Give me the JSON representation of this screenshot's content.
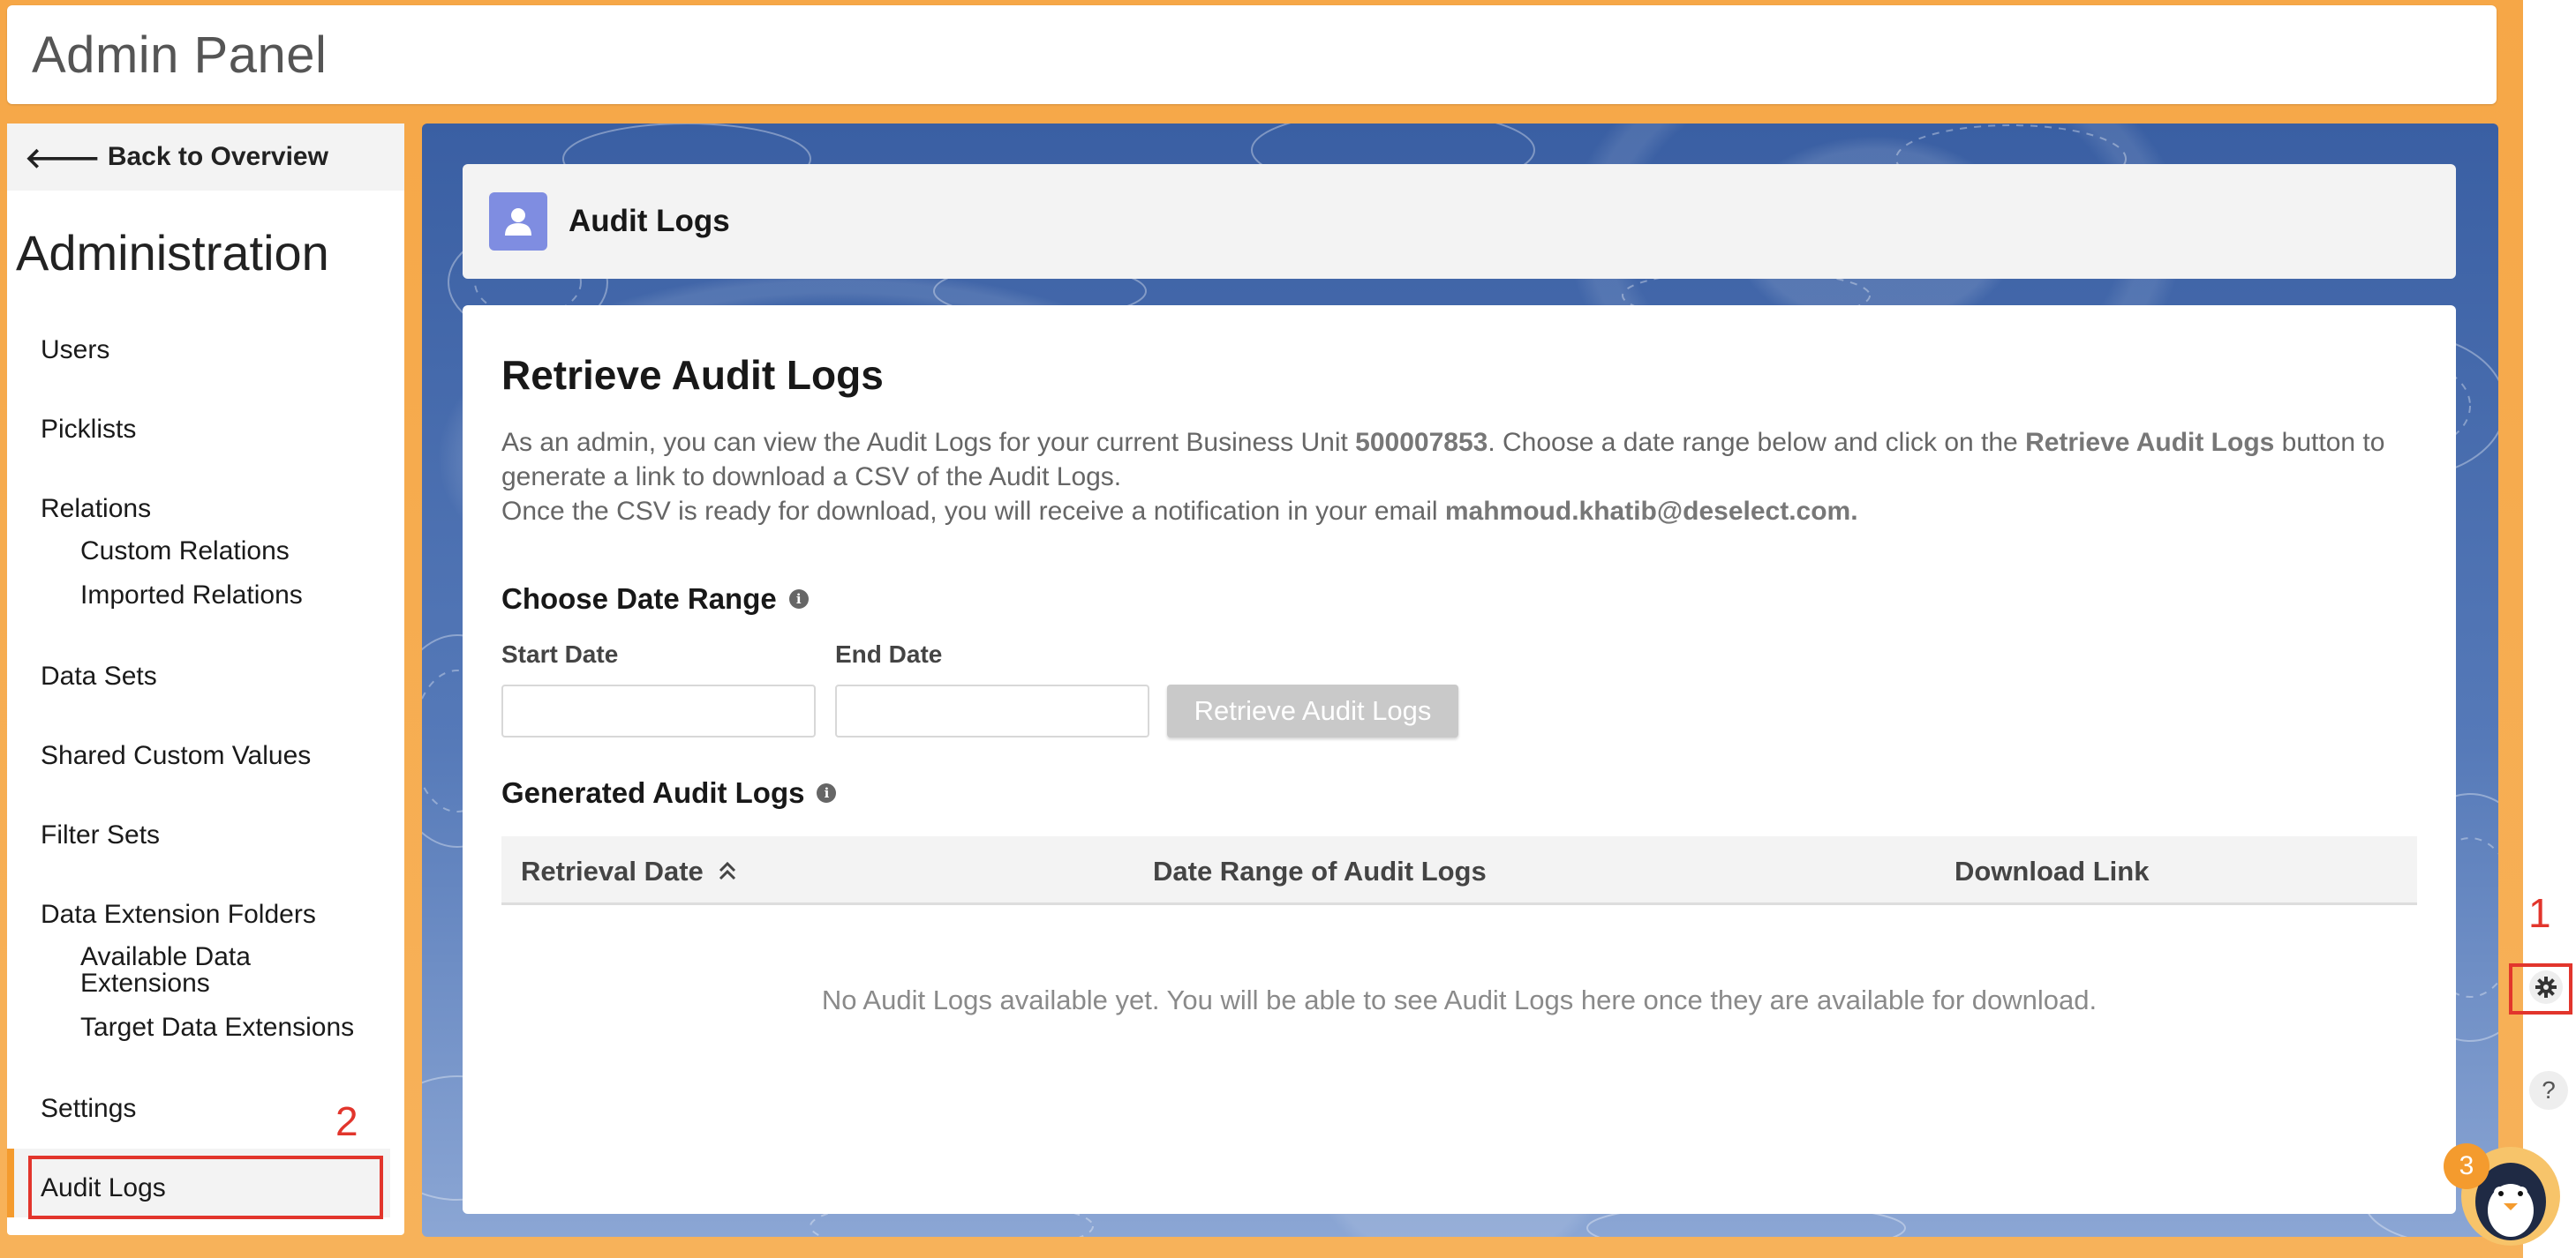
{
  "app": {
    "title": "Admin Panel"
  },
  "sidebar": {
    "back_label": "Back to Overview",
    "heading": "Administration",
    "items": [
      {
        "label": "Users"
      },
      {
        "label": "Picklists"
      },
      {
        "label": "Relations"
      },
      {
        "label": "Custom Relations"
      },
      {
        "label": "Imported Relations"
      },
      {
        "label": "Data Sets"
      },
      {
        "label": "Shared Custom Values"
      },
      {
        "label": "Filter Sets"
      },
      {
        "label": "Data Extension Folders"
      },
      {
        "label": "Available Data Extensions"
      },
      {
        "label": "Target Data Extensions"
      },
      {
        "label": "Settings"
      },
      {
        "label": "Audit Logs"
      }
    ],
    "active_item": "Audit Logs"
  },
  "page": {
    "header_title": "Audit Logs",
    "heading": "Retrieve Audit Logs",
    "desc_part1": "As an admin, you can view the Audit Logs for your current Business Unit ",
    "business_unit": "500007853",
    "desc_part2": ". Choose a date range below and click on the ",
    "desc_button_ref": "Retrieve Audit Logs",
    "desc_part3": " button to generate a link to download a CSV of the Audit Logs.",
    "desc_line2": "Once the CSV is ready for download, you will receive a notification in your email ",
    "email": "mahmoud.khatib@deselect.com.",
    "date_range_title": "Choose Date Range",
    "start_date_label": "Start Date",
    "start_date_value": "",
    "end_date_label": "End Date",
    "end_date_value": "",
    "retrieve_button": "Retrieve Audit Logs",
    "generated_title": "Generated Audit Logs",
    "table": {
      "columns": [
        "Retrieval Date",
        "Date Range of Audit Logs",
        "Download Link"
      ],
      "rows": [],
      "empty_message": "No Audit Logs available yet. You will be able to see Audit Logs here once they are available for download."
    }
  },
  "annotations": {
    "one": "1",
    "two": "2",
    "three": "3"
  },
  "right_controls": {
    "help": "?",
    "notification_count": "3"
  },
  "colors": {
    "accent": "#f49b2e",
    "annotation": "#e2352c",
    "icon_bg": "#7f8de1",
    "button_disabled": "#c9c9c9"
  }
}
